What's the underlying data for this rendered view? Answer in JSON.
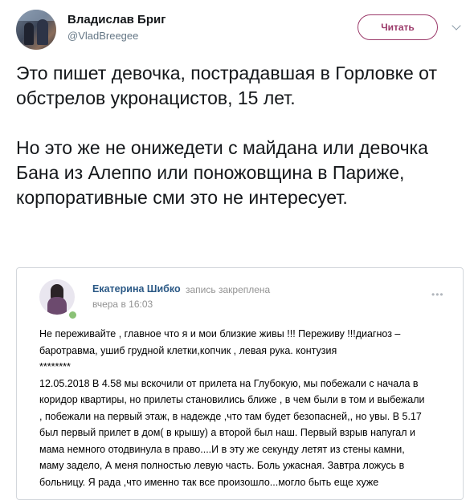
{
  "tweet": {
    "author_name": "Владислав Бриг",
    "author_handle": "@VladBreegee",
    "follow_label": "Читать",
    "paragraph1": "Это пишет девочка, пострадавшая в Горловке от обстрелов укронацистов, 15 лет.",
    "paragraph2": "Но это же не онижедети с майдана или девочка Бана из Алеппо или поножовщина в Париже, корпоративные сми это не интересует."
  },
  "vk_post": {
    "author_name": "Екатерина Шибко",
    "pinned_label": "запись закреплена",
    "time": "вчера в 16:03",
    "menu_dots": "•••",
    "lines": [
      "Не переживайте , главное что я и мои близкие живы !!! Переживу !!!диагноз –",
      "баротравма, ушиб грудной клетки,копчик , левая рука. контузия",
      "********",
      "12.05.2018 В 4.58 мы вскочили от прилета на Глубокую, мы побежали с начала в",
      "коридор квартиры, но прилеты становились ближе , в чем были в том и выбежали",
      ", побежали на первый этаж, в надежде ,что там будет безопасней,, но увы. В 5.17",
      "был первый прилет в дом( в крышу) а второй был наш. Первый взрыв напугал и",
      "мама немного отодвинула в право....И в эту же секунду летят из стены камни,",
      "маму задело, А меня полностью левую часть. Боль ужасная. Завтра ложусь в",
      "больницу. Я рада ,что именно так все произошло...могло быть еще хуже"
    ]
  }
}
